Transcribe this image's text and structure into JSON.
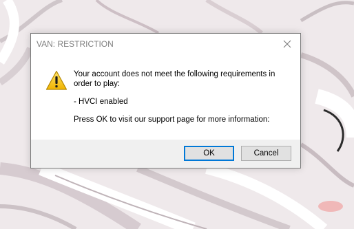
{
  "dialog": {
    "title": "VAN: RESTRICTION",
    "close_icon": "close-icon",
    "warning_icon": "warning-icon",
    "message": {
      "line1": "Your account does not meet the following requirements in order to play:",
      "requirement": "- HVCI enabled",
      "line3": "Press OK to visit our support page for more information:"
    },
    "buttons": {
      "ok_label": "OK",
      "cancel_label": "Cancel"
    }
  },
  "colors": {
    "accent": "#0078d7",
    "title_text": "#7f7f7f",
    "footer_bg": "#f0f0f0",
    "warning_yellow": "#f2c40f"
  }
}
